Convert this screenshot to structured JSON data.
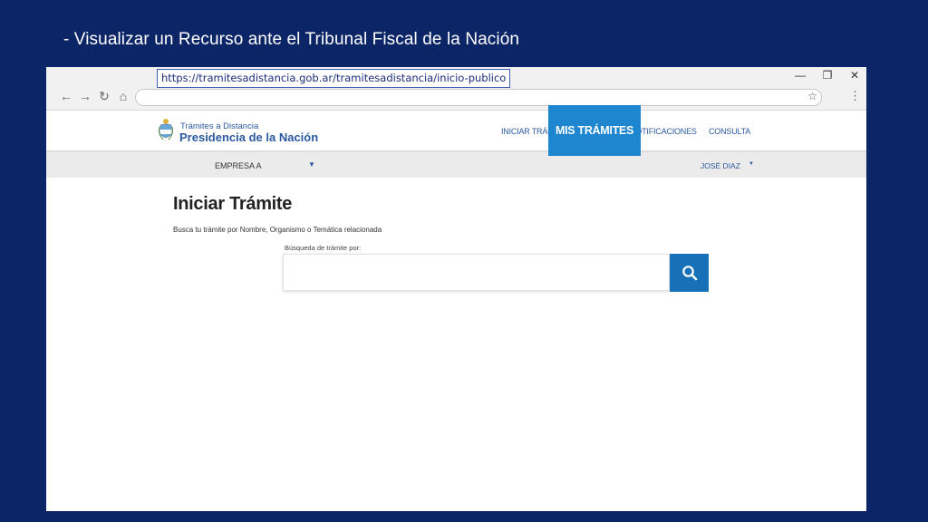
{
  "slide": {
    "title": "- Visualizar un Recurso ante el Tribunal Fiscal de la Nación"
  },
  "window": {
    "minimize": "—",
    "restore": "❐",
    "close": "✕"
  },
  "browser": {
    "back": "←",
    "forward": "→",
    "reload": "↻",
    "home": "⌂",
    "url": "https://tramitesadistancia.gob.ar/tramitesadistancia/inicio-publico",
    "star": "☆",
    "menu": "⋮"
  },
  "site": {
    "logo_small": "Trámites a Distancia",
    "logo_big": "Presidencia de la Nación",
    "nav": {
      "iniciar": "INICIAR TRÁMITE",
      "mis_tramites": "MIS TRÁMITES",
      "notificaciones": "NOTIFICACIONES",
      "consulta": "CONSULTA"
    },
    "subbar": {
      "empresa": "EMPRESA A",
      "user": "JOSÉ DIAZ"
    }
  },
  "page": {
    "title": "Iniciar Trámite",
    "subtitle": "Busca tu trámite por Nombre, Organismo o Temática relacionada",
    "search_label": "Búsqueda de trámite por:",
    "search_value": ""
  },
  "colors": {
    "slide_bg": "#0b2566",
    "accent": "#1e86cf",
    "search_button": "#1870b8",
    "brand_text": "#2b5aa0"
  },
  "icons": {
    "search": "search-icon",
    "dropdown": "caret-down-icon",
    "emblem": "coat-of-arms-icon"
  }
}
